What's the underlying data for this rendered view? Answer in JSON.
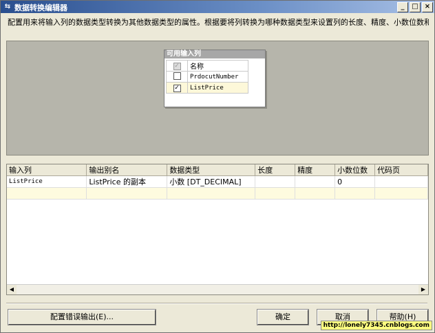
{
  "window": {
    "title": "数据转换编辑器",
    "icon": "transform-icon",
    "controls": [
      "_",
      "□",
      "×"
    ]
  },
  "description": "配置用来将输入列的数据类型转换为其他数据类型的属性。根据要将列转换为哪种数据类型来设置列的长度、精度、小数位数和代码页。",
  "available_columns": {
    "header": "可用输入列",
    "name_header": "名称",
    "rows": [
      {
        "name": "PrdocutNumber",
        "checked": false
      },
      {
        "name": "ListPrice",
        "checked": true
      }
    ]
  },
  "grid": {
    "columns": [
      "输入列",
      "输出别名",
      "数据类型",
      "长度",
      "精度",
      "小数位数",
      "代码页"
    ],
    "rows": [
      [
        "ListPrice",
        "ListPrice 的副本",
        "小数 [DT_DECIMAL]",
        "",
        "",
        "0",
        ""
      ]
    ]
  },
  "buttons": {
    "error_output": "配置错误输出(E)...",
    "ok": "确定",
    "cancel": "取消",
    "help": "帮助(H)"
  },
  "watermark": "http://lonely7345.cnblogs.com"
}
